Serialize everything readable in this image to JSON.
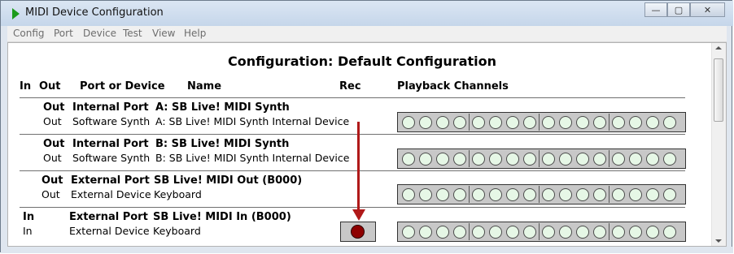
{
  "window": {
    "title": "MIDI Device Configuration",
    "buttons": {
      "minimize": "—",
      "maximize": "▢",
      "close": "✕"
    }
  },
  "menu": [
    "Config",
    "Port",
    "Device",
    "Test",
    "View",
    "Help"
  ],
  "config_title": "Configuration: Default Configuration",
  "headers": {
    "in": "In",
    "out": "Out",
    "port_or_device": "Port or Device",
    "name": "Name",
    "rec": "Rec",
    "playback": "Playback Channels"
  },
  "rows": [
    {
      "port": {
        "dir": "Out",
        "type": "Internal Port",
        "name": "A:  SB Live! MIDI Synth"
      },
      "device": {
        "dir": "Out",
        "type": "Software Synth",
        "name": "A: SB Live! MIDI Synth Internal Device"
      }
    },
    {
      "port": {
        "dir": "Out",
        "type": "Internal Port",
        "name": "B:  SB Live! MIDI Synth"
      },
      "device": {
        "dir": "Out",
        "type": "Software Synth",
        "name": "B: SB Live! MIDI Synth Internal Device"
      }
    },
    {
      "port": {
        "dir": "Out",
        "type": "External Port",
        "name": "SB Live! MIDI Out (B000)"
      },
      "device": {
        "dir": "Out",
        "type": "External Device",
        "name": "Keyboard"
      }
    },
    {
      "port": {
        "dir": "In",
        "type": "External Port",
        "name": "SB Live! MIDI In (B000)"
      },
      "device": {
        "dir": "In",
        "type": "External Device",
        "name": "Keyboard"
      },
      "rec": true
    }
  ],
  "playback_channels_per_row": 16,
  "colors": {
    "annotation_arrow": "#b01919",
    "rec_indicator": "#8e0000",
    "channel_led": "#e6f7e6"
  },
  "icons": {
    "title": "play-triangle-icon",
    "annotation": "red-arrow-icon"
  }
}
